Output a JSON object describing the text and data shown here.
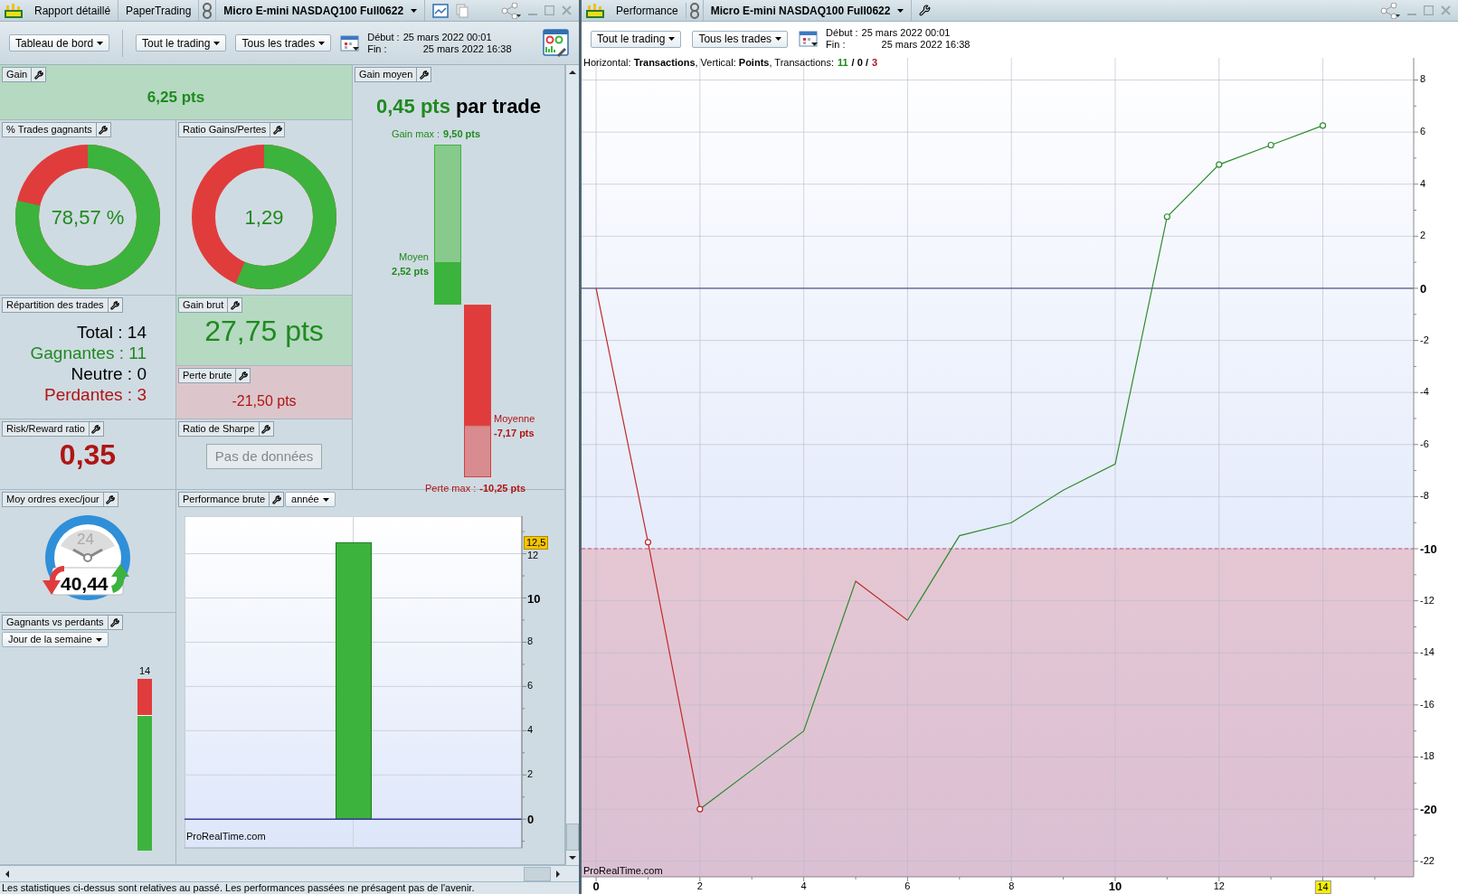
{
  "dashboard_window": {
    "tabs": [
      "Rapport détaillé",
      "PaperTrading"
    ],
    "instrument": "Micro E-mini NASDAQ100 Full0622",
    "toolbar": {
      "dropdowns": [
        "Tableau de bord",
        "Tout le trading",
        "Tous les trades"
      ],
      "start_label": "Début :",
      "start": "25 mars 2022 00:01",
      "end_label": "Fin :",
      "end": "25 mars 2022 16:38"
    },
    "gain": {
      "title": "Gain",
      "value": "6,25 pts"
    },
    "average_gain": {
      "title": "Gain moyen",
      "value": "0,45 pts",
      "suffix": "par trade",
      "max_gain_label": "Gain max :",
      "max_gain": "9,50 pts",
      "avg_gain_label": "Moyen",
      "avg_gain": "2,52 pts",
      "avg_loss_label": "Moyenne",
      "avg_loss": "-7,17 pts",
      "max_loss_label": "Perte max :",
      "max_loss": "-10,25 pts"
    },
    "win_rate": {
      "title": "% Trades gagnants",
      "value": "78,57 %",
      "level": 0.7857
    },
    "gain_loss_ratio": {
      "title": "Ratio Gains/Pertes",
      "value": "1,29",
      "level": 0.5635
    },
    "trade_breakdown": {
      "title": "Répartition des trades",
      "rows": [
        {
          "text": "Total : 14",
          "kind": "total"
        },
        {
          "text": "Gagnantes : 11",
          "kind": "win"
        },
        {
          "text": "Neutre : 0",
          "kind": "neutral"
        },
        {
          "text": "Perdantes : 3",
          "kind": "loss"
        }
      ]
    },
    "gross_gain": {
      "title": "Gain brut",
      "value": "27,75 pts"
    },
    "gross_loss": {
      "title": "Perte brute",
      "value": "-21,50 pts"
    },
    "risk_reward": {
      "title": "Risk/Reward ratio",
      "value": "0,35"
    },
    "sharpe": {
      "title": "Ratio de Sharpe",
      "button": "Pas de données"
    },
    "daily_orders": {
      "title": "Moy ordres exec/jour",
      "dial": "24",
      "value": "40,44"
    },
    "gross_performance": {
      "title": "Performance brute",
      "period": "année",
      "watermark": "ProRealTime.com",
      "axis_marker": "12,5",
      "chart_data": {
        "type": "bar",
        "categories": [
          null
        ],
        "values": [
          12.5
        ],
        "ylim": [
          -1.3,
          13.7
        ],
        "yticks": [
          0,
          2,
          4,
          6,
          8,
          10,
          12
        ],
        "grid": true,
        "ref_lines": [
          {
            "axis": "y",
            "value": 0,
            "color": "#3a3a9a"
          }
        ]
      }
    },
    "winners_losers": {
      "title": "Gagnants vs perdants",
      "period": "Jour de la semaine",
      "bar": {
        "label": "14",
        "level": 0.786
      }
    },
    "status_bar": "Les statistiques ci-dessus sont relatives au passé. Les performances passées ne présagent pas de l'avenir."
  },
  "performance_window": {
    "title": "Performance",
    "instrument": "Micro E-mini NASDAQ100 Full0622",
    "toolbar": {
      "dropdowns": [
        "Tout le trading",
        "Tous les trades"
      ],
      "start_label": "Début :",
      "start": "25 mars 2022 00:01",
      "end_label": "Fin :",
      "end": "25 mars 2022 16:38"
    },
    "caption": "Horizontal: **Transactions**, Vertical: **Points**, Transactions:",
    "counts": [
      {
        "text": "11",
        "kind": "win"
      },
      {
        "text": "/ 0 /",
        "kind": "neutral"
      },
      {
        "text": "3",
        "kind": "loss"
      }
    ],
    "watermark": "ProRealTime.com",
    "chart_data": {
      "type": "line",
      "x": [
        0,
        1,
        2,
        3,
        4,
        5,
        6,
        7,
        8,
        9,
        10,
        11,
        12,
        13,
        14
      ],
      "series": [
        {
          "color": "#2e8b2e",
          "values": [
            0,
            -9.75,
            -20,
            -18.5,
            -17,
            -11.25,
            -12.75,
            -9.5,
            -9,
            -7.75,
            -6.75,
            2.75,
            4.75,
            5.5,
            6.25
          ]
        }
      ],
      "xlim": [
        -0.28,
        15.75
      ],
      "ylim": [
        -22.6,
        8.85
      ],
      "xticks": [
        0,
        2,
        4,
        6,
        8,
        10,
        12,
        14
      ],
      "yticks": [
        8,
        6,
        4,
        2,
        0,
        -2,
        -4,
        -6,
        -8,
        -10,
        -12,
        -14,
        -16,
        -18,
        -20,
        -22
      ],
      "grid": true,
      "ref_lines": [
        {
          "axis": "y",
          "value": 0,
          "color": "#3a3a7a"
        },
        {
          "axis": "y",
          "value": -10,
          "color": "#d0506a"
        }
      ]
    }
  }
}
